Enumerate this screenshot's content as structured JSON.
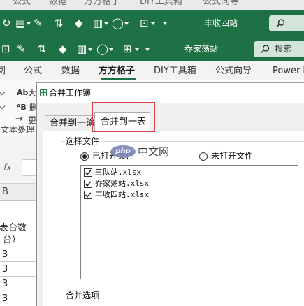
{
  "colors": {
    "excel_green": "#1e7145",
    "highlight_red": "#d94444",
    "watermark_oval": "#7d87b8"
  },
  "top_strip": {
    "tabs": [
      "公式",
      "数据",
      "方方格子",
      "DIY工具箱",
      "公式向导"
    ]
  },
  "toolbar_1": {
    "icons": [
      {
        "name": "refresh-icon",
        "glyph": "↻"
      },
      {
        "name": "paste-icon",
        "glyph": "▤"
      },
      {
        "name": "format-painter-icon",
        "glyph": "✎"
      },
      {
        "name": "sort-icon",
        "glyph": "⇅"
      },
      {
        "name": "fill-color-icon",
        "glyph": "◆"
      },
      {
        "name": "chart-icon",
        "glyph": "▥"
      },
      {
        "name": "shape-icon",
        "glyph": "◯"
      },
      {
        "name": "textbox-icon",
        "glyph": "⊡"
      }
    ],
    "workbook_name": "丰收四站",
    "search_icon": "search-icon"
  },
  "toolbar_2": {
    "icons": [
      {
        "name": "textbox-icon",
        "glyph": "⊡"
      },
      {
        "name": "format-painter-icon",
        "glyph": "✎"
      },
      {
        "name": "sort-icon",
        "glyph": "⇅"
      },
      {
        "name": "fill-color-icon",
        "glyph": "◆"
      },
      {
        "name": "chart-icon",
        "glyph": "▥"
      },
      {
        "name": "shape-icon",
        "glyph": "◯"
      },
      {
        "name": "table-icon",
        "glyph": "⊞"
      }
    ],
    "workbook_name": "乔家荡站",
    "search_label": "搜索"
  },
  "ribbon": {
    "tabs": [
      {
        "label": "阅"
      },
      {
        "label": "公式"
      },
      {
        "label": "数据"
      },
      {
        "label": "方方格子",
        "active": true
      },
      {
        "label": "DIY工具箱"
      },
      {
        "label": "公式向导"
      },
      {
        "label": "Power P"
      }
    ],
    "items": [
      {
        "icon": "text-case-icon",
        "glyph": "Ab",
        "label": "大"
      },
      {
        "icon": "change-case-icon",
        "glyph": "ᴬB",
        "label": "删"
      },
      {
        "icon": "arrow-right-icon",
        "glyph": "→",
        "label": "更"
      }
    ],
    "group_label": "文本处理"
  },
  "formula_bar": {
    "fx_label": "fx"
  },
  "sheet": {
    "column_header": "B",
    "header_lines": [
      "表台数",
      "台）"
    ],
    "values": [
      "3",
      "3",
      "3",
      "3"
    ]
  },
  "dialog": {
    "title": "合并工作簿",
    "tabs": [
      {
        "label": "合并到一簿",
        "active": false
      },
      {
        "label": "合并到一表",
        "active": true,
        "highlighted": true
      }
    ],
    "file_group": {
      "label": "选择文件",
      "radios": [
        {
          "label": "已打开文件",
          "selected": true
        },
        {
          "label": "未打开文件",
          "selected": false
        }
      ],
      "files": [
        {
          "name": "三队站.xlsx",
          "checked": true
        },
        {
          "name": "乔家荡站.xlsx",
          "checked": true
        },
        {
          "name": "丰收四站.xlsx",
          "checked": true
        }
      ]
    },
    "options_group": {
      "label": "合并选项"
    }
  },
  "watermark": {
    "logo": "php",
    "text": "中文网"
  }
}
